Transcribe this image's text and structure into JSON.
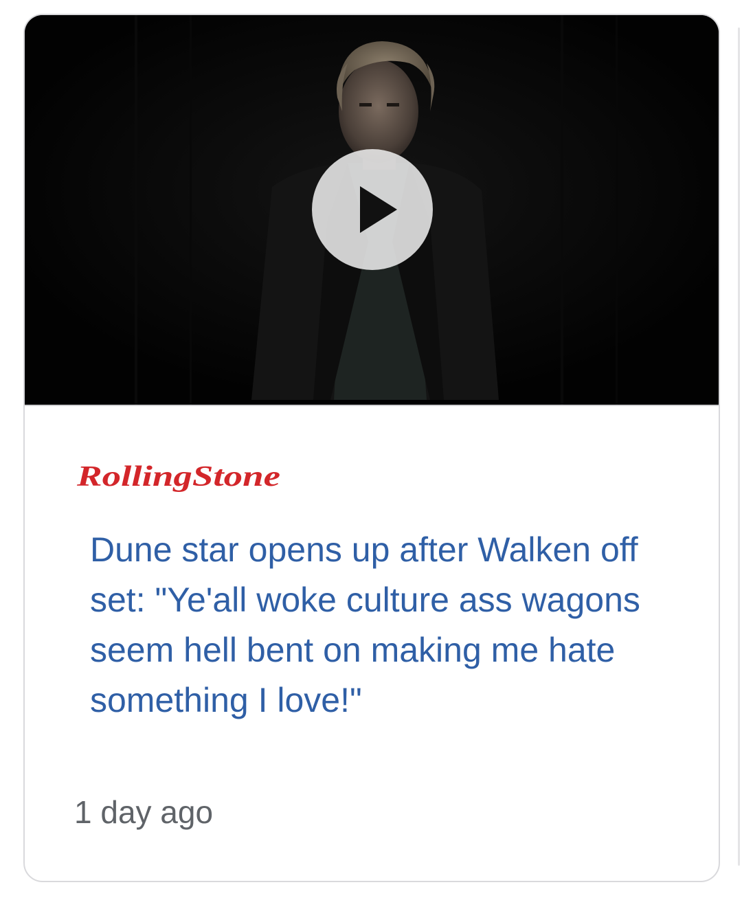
{
  "article": {
    "publisher": "RollingStone",
    "headline": "Dune star opens up after Walken off set: \"Ye'all woke culture ass wagons seem hell bent on making me hate something I love!\"",
    "timestamp": "1 day ago",
    "media_type": "video",
    "play_icon": "play-icon"
  },
  "colors": {
    "headline": "#2f5fa6",
    "publisher_logo": "#d3262a",
    "timestamp": "#5f6368",
    "thumbnail_background": "#030303"
  }
}
